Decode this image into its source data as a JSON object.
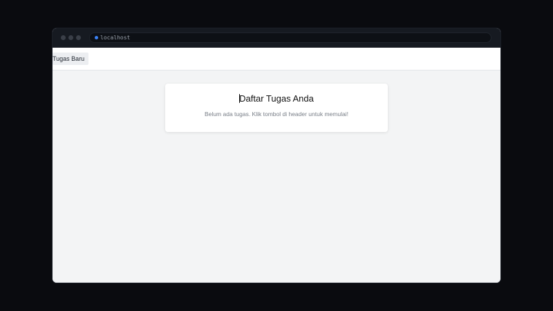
{
  "browser": {
    "url": "localhost",
    "accent_color": "#3b82f6"
  },
  "header": {
    "new_task_label": "Tugas Baru"
  },
  "tasks": {
    "title": "Daftar Tugas Anda",
    "empty_message": "Belum ada tugas. Klik tombol di header untuk memulai!"
  }
}
